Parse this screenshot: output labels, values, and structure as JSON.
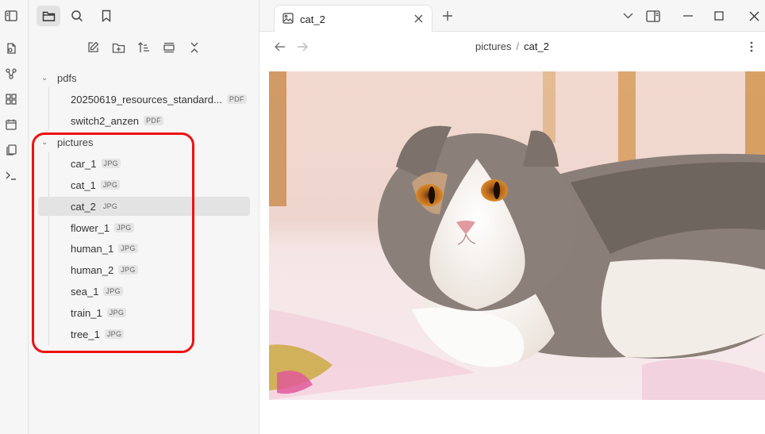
{
  "tabs": [
    {
      "label": "cat_2"
    }
  ],
  "breadcrumb": {
    "folder": "pictures",
    "separator": "/",
    "file": "cat_2"
  },
  "tree": {
    "folders": [
      {
        "name": "pdfs",
        "files": [
          {
            "name": "20250619_resources_standard...",
            "ext": "PDF"
          },
          {
            "name": "switch2_anzen",
            "ext": "PDF"
          }
        ]
      },
      {
        "name": "pictures",
        "files": [
          {
            "name": "car_1",
            "ext": "JPG"
          },
          {
            "name": "cat_1",
            "ext": "JPG"
          },
          {
            "name": "cat_2",
            "ext": "JPG"
          },
          {
            "name": "flower_1",
            "ext": "JPG"
          },
          {
            "name": "human_1",
            "ext": "JPG"
          },
          {
            "name": "human_2",
            "ext": "JPG"
          },
          {
            "name": "sea_1",
            "ext": "JPG"
          },
          {
            "name": "train_1",
            "ext": "JPG"
          },
          {
            "name": "tree_1",
            "ext": "JPG"
          }
        ]
      }
    ]
  },
  "selected_file": "cat_2",
  "colors": {
    "highlight": "#ee1111",
    "selected_row": "#e3e3e3",
    "sidebar_bg": "#f6f6f6"
  },
  "icons": {
    "ribbon": [
      "open-quick-switcher-icon",
      "graph-view-icon",
      "canvas-icon",
      "daily-note-icon",
      "templates-icon",
      "command-palette-icon"
    ],
    "sidebar_top": [
      "sidebar-toggle-icon",
      "folder-icon",
      "search-icon",
      "bookmark-icon"
    ],
    "file_actions": [
      "new-note-icon",
      "new-folder-icon",
      "sort-icon",
      "auto-reveal-icon",
      "collapse-all-icon"
    ]
  }
}
